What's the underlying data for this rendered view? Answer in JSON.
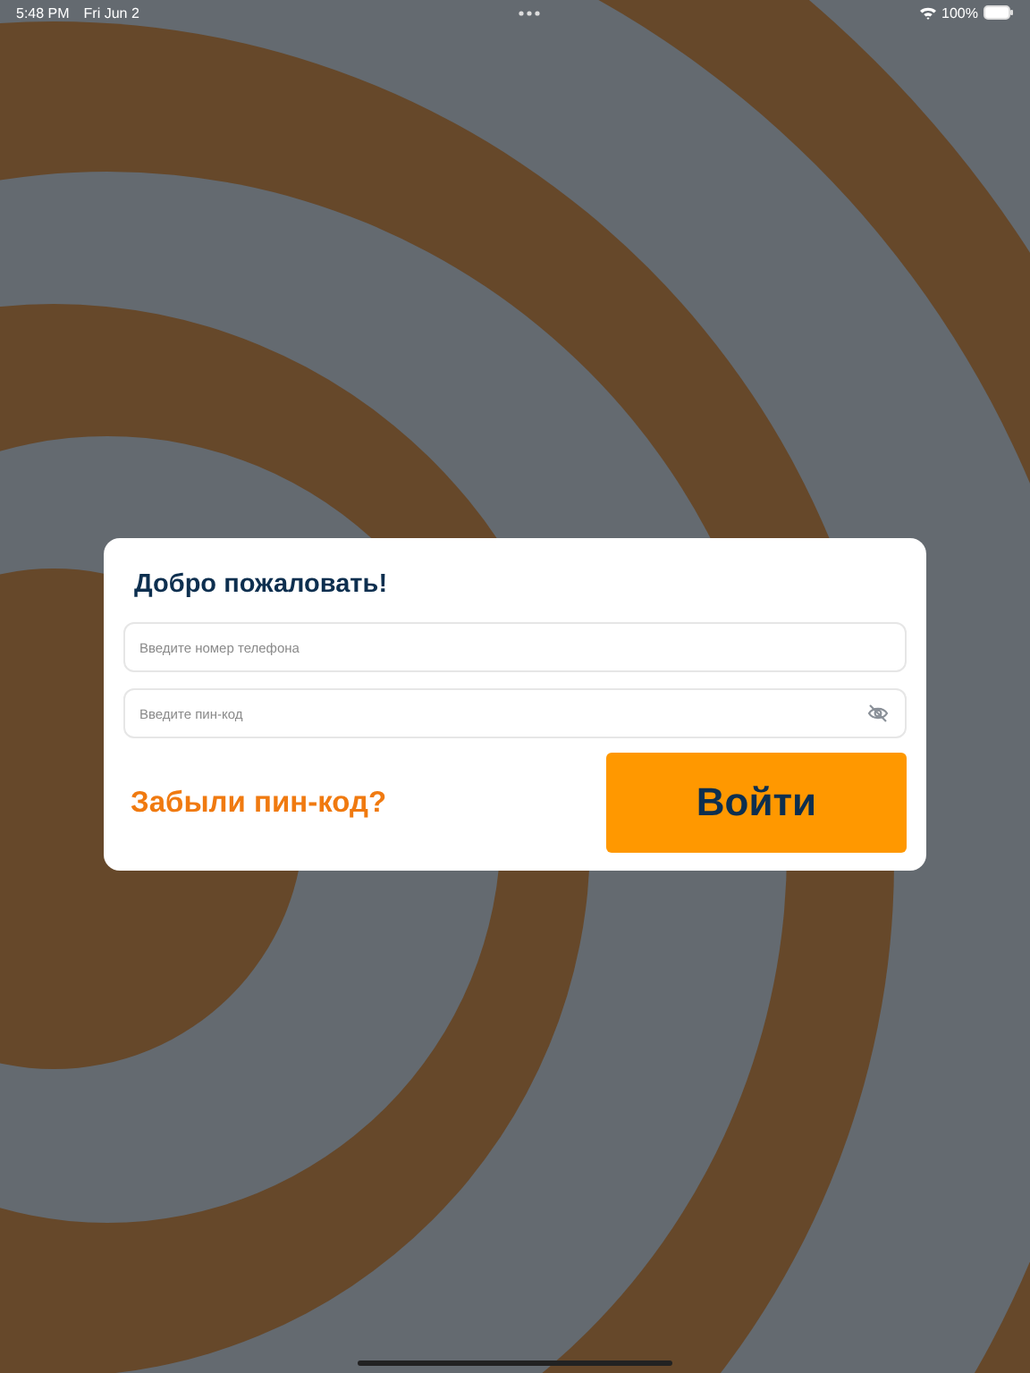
{
  "status_bar": {
    "time": "5:48 PM",
    "date": "Fri Jun 2",
    "battery": "100%"
  },
  "login": {
    "title": "Добро пожаловать!",
    "phone_field": {
      "placeholder": "Введите номер телефона"
    },
    "pin_field": {
      "placeholder": "Введите пин-код"
    },
    "forgot_link": "Забыли пин-код?",
    "submit_button": "Войти"
  }
}
